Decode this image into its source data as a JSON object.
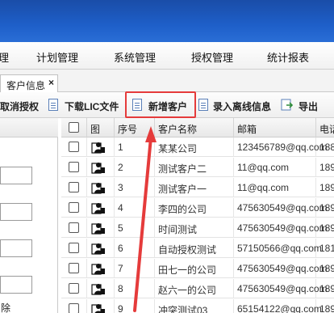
{
  "menu": {
    "items": [
      {
        "label": "理"
      },
      {
        "label": "计划管理"
      },
      {
        "label": "系统管理"
      },
      {
        "label": "授权管理"
      },
      {
        "label": "统计报表"
      }
    ]
  },
  "tabs": {
    "active_label": "客户信息",
    "close_glyph": "×"
  },
  "toolbar": {
    "cancel_auth": "取消授权",
    "download_lic": "下载LIC文件",
    "add_customer": "新增客户",
    "import_offline": "录入离线信息",
    "export": "导出"
  },
  "left_panel": {
    "bottom_text": "除"
  },
  "grid": {
    "columns": [
      "图",
      "序号",
      "客户名称",
      "邮箱",
      "电话"
    ],
    "rows": [
      {
        "index": "1",
        "name": "某某公司",
        "email": "123456789@qq.com",
        "phone": "188"
      },
      {
        "index": "2",
        "name": "测试客户二",
        "email": "11@qq.com",
        "phone": "189"
      },
      {
        "index": "3",
        "name": "测试客户一",
        "email": "11@qq.com",
        "phone": "189"
      },
      {
        "index": "4",
        "name": "李四的公司",
        "email": "475630549@qq.com",
        "phone": "189"
      },
      {
        "index": "5",
        "name": "时间测试",
        "email": "475630549@qq.com",
        "phone": "189"
      },
      {
        "index": "6",
        "name": "自动授权测试",
        "email": "57150566@qq.com",
        "phone": "181"
      },
      {
        "index": "7",
        "name": "田七一的公司",
        "email": "475630549@qq.com",
        "phone": "189"
      },
      {
        "index": "8",
        "name": "赵六一的公司",
        "email": "475630549@qq.com",
        "phone": "189"
      },
      {
        "index": "9",
        "name": "冲突测试03",
        "email": "65154122@qq.com",
        "phone": "189"
      }
    ]
  },
  "colors": {
    "header_blue": "#1e5fc9",
    "highlight_red": "#e53b3b",
    "arrow_red": "#e53b3b"
  },
  "icons": {
    "doc": "document-icon",
    "export": "export-icon",
    "user": "user-icon"
  }
}
